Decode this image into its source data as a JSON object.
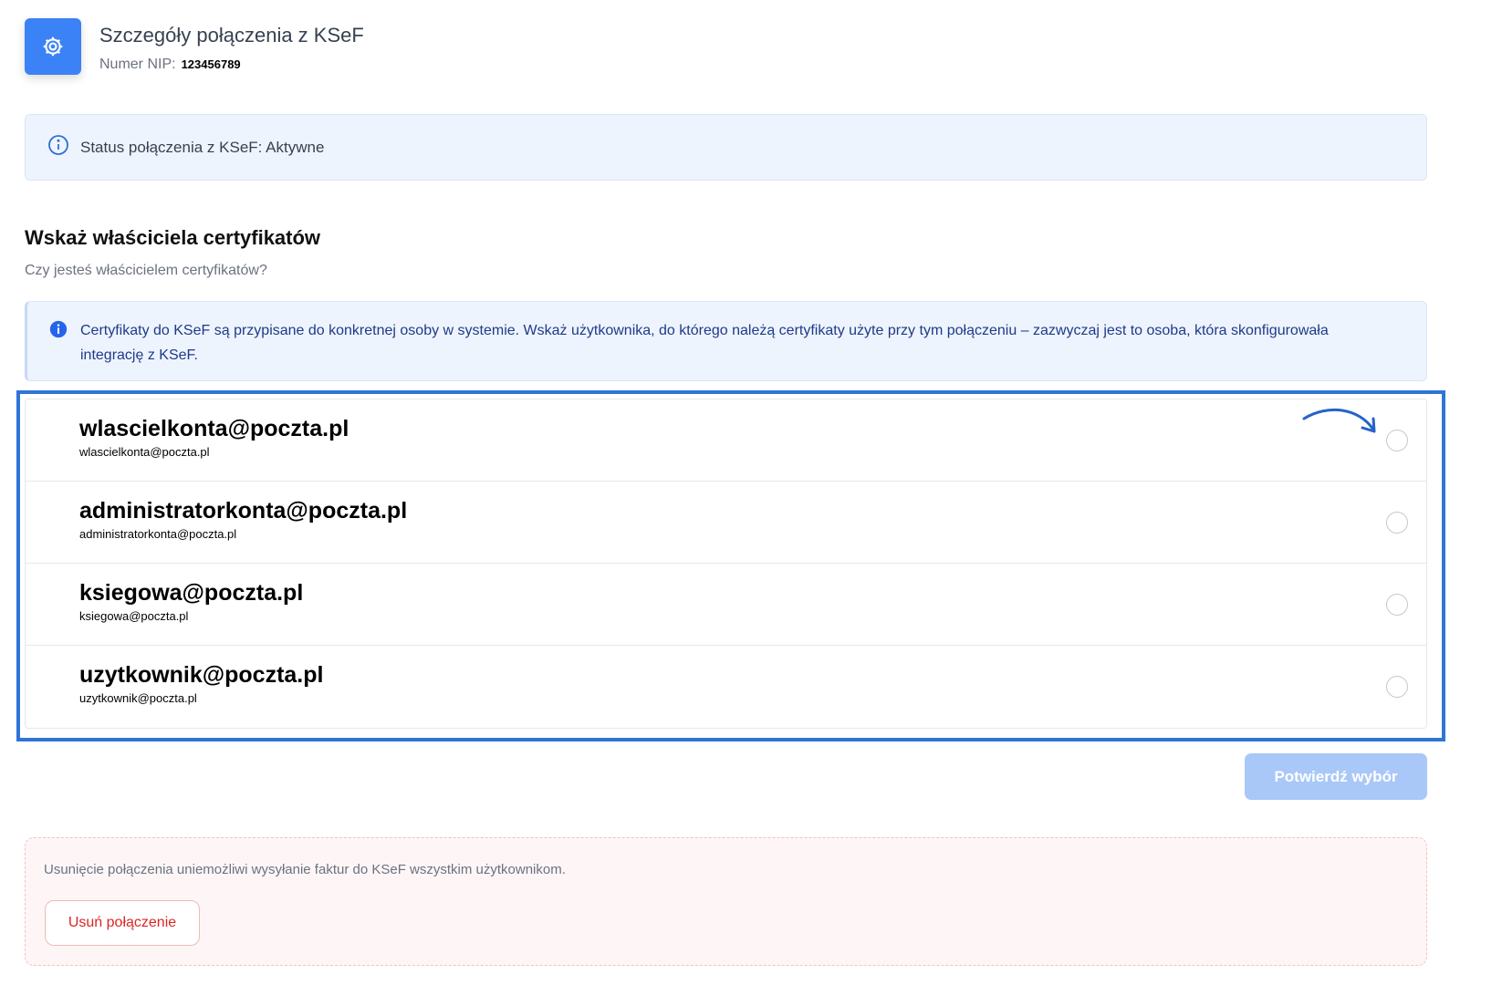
{
  "header": {
    "icon": "gear-icon",
    "title": "Szczegóły połączenia z KSeF",
    "nip_label": "Numer NIP:",
    "nip_value": "123456789"
  },
  "status": {
    "icon": "info-outline-icon",
    "text": "Status połączenia z KSeF: Aktywne"
  },
  "owner_section": {
    "title": "Wskaż właściciela certyfikatów",
    "subtitle": "Czy jesteś właścicielem certyfikatów?",
    "info_icon": "info-filled-icon",
    "info_text": "Certyfikaty do KSeF są przypisane do konkretnej osoby w systemie. Wskaż użytkownika, do którego należą certyfikaty użyte przy tym połączeniu – zazwyczaj jest to osoba, która skonfigurowała integrację z KSeF."
  },
  "users": [
    {
      "name": "wlascielkonta@poczta.pl",
      "email": "wlascielkonta@poczta.pl",
      "selected": false
    },
    {
      "name": "administratorkonta@poczta.pl",
      "email": "administratorkonta@poczta.pl",
      "selected": false
    },
    {
      "name": "ksiegowa@poczta.pl",
      "email": "ksiegowa@poczta.pl",
      "selected": false
    },
    {
      "name": "uzytkownik@poczta.pl",
      "email": "uzytkownik@poczta.pl",
      "selected": false
    }
  ],
  "confirm_button": {
    "label": "Potwierdź wybór",
    "disabled": true
  },
  "danger_zone": {
    "text": "Usunięcie połączenia uniemożliwi wysyłanie faktur do KSeF wszystkim użytkownikom.",
    "button_label": "Usuń połączenie"
  },
  "colors": {
    "primary": "#3b82f6",
    "highlight_border": "#2f74d8",
    "info_bg": "#eef4fd",
    "danger": "#dc2626",
    "confirm_disabled": "#a9c8f8"
  }
}
